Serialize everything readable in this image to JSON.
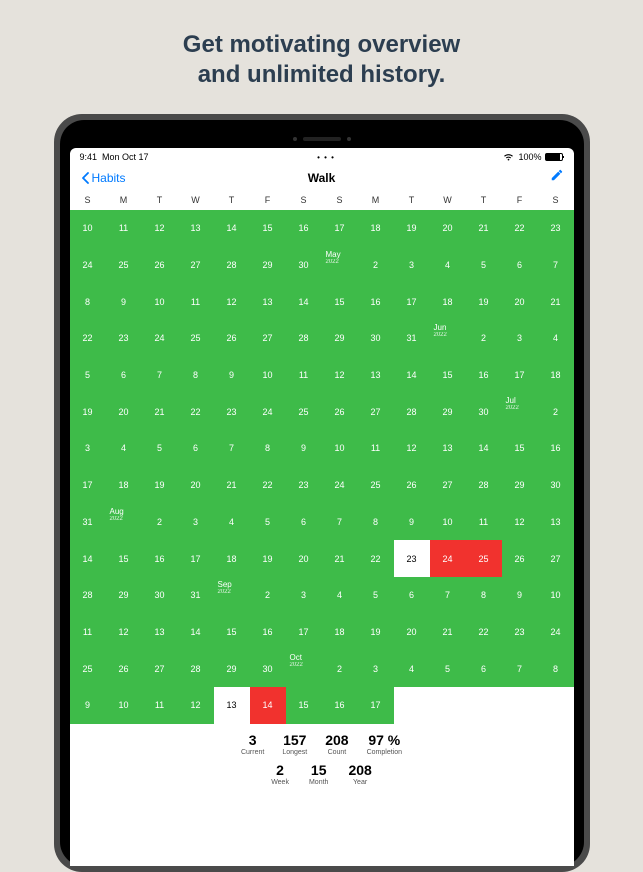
{
  "hero": {
    "line1": "Get motivating overview",
    "line2": "and unlimited history."
  },
  "statusbar": {
    "time": "9:41",
    "date": "Mon Oct 17",
    "battery_pct": "100%"
  },
  "nav": {
    "back_label": "Habits",
    "title": "Walk"
  },
  "day_headers": [
    "S",
    "M",
    "T",
    "W",
    "T",
    "F",
    "S",
    "S",
    "M",
    "T",
    "W",
    "T",
    "F",
    "S"
  ],
  "months": {
    "may": {
      "name": "May",
      "year": "2022"
    },
    "jun": {
      "name": "Jun",
      "year": "2022"
    },
    "jul": {
      "name": "Jul",
      "year": "2022"
    },
    "aug": {
      "name": "Aug",
      "year": "2022"
    },
    "sep": {
      "name": "Sep",
      "year": "2022"
    },
    "oct": {
      "name": "Oct",
      "year": "2022"
    }
  },
  "grid_rows": [
    [
      {
        "d": "10",
        "s": "g"
      },
      {
        "d": "11",
        "s": "g"
      },
      {
        "d": "12",
        "s": "g"
      },
      {
        "d": "13",
        "s": "g"
      },
      {
        "d": "14",
        "s": "g"
      },
      {
        "d": "15",
        "s": "g"
      },
      {
        "d": "16",
        "s": "g"
      },
      {
        "d": "17",
        "s": "g"
      },
      {
        "d": "18",
        "s": "g"
      },
      {
        "d": "19",
        "s": "g"
      },
      {
        "d": "20",
        "s": "g"
      },
      {
        "d": "21",
        "s": "g"
      },
      {
        "d": "22",
        "s": "g"
      },
      {
        "d": "23",
        "s": "g"
      }
    ],
    [
      {
        "d": "24",
        "s": "g"
      },
      {
        "d": "25",
        "s": "g"
      },
      {
        "d": "26",
        "s": "g"
      },
      {
        "d": "27",
        "s": "g"
      },
      {
        "d": "28",
        "s": "g"
      },
      {
        "d": "29",
        "s": "g"
      },
      {
        "d": "30",
        "s": "g"
      },
      {
        "d": "",
        "s": "g",
        "m": "may"
      },
      {
        "d": "2",
        "s": "g"
      },
      {
        "d": "3",
        "s": "g"
      },
      {
        "d": "4",
        "s": "g"
      },
      {
        "d": "5",
        "s": "g"
      },
      {
        "d": "6",
        "s": "g"
      },
      {
        "d": "7",
        "s": "g"
      }
    ],
    [
      {
        "d": "8",
        "s": "g"
      },
      {
        "d": "9",
        "s": "g"
      },
      {
        "d": "10",
        "s": "g"
      },
      {
        "d": "11",
        "s": "g"
      },
      {
        "d": "12",
        "s": "g"
      },
      {
        "d": "13",
        "s": "g"
      },
      {
        "d": "14",
        "s": "g"
      },
      {
        "d": "15",
        "s": "g"
      },
      {
        "d": "16",
        "s": "g"
      },
      {
        "d": "17",
        "s": "g"
      },
      {
        "d": "18",
        "s": "g"
      },
      {
        "d": "19",
        "s": "g"
      },
      {
        "d": "20",
        "s": "g"
      },
      {
        "d": "21",
        "s": "g"
      }
    ],
    [
      {
        "d": "22",
        "s": "g"
      },
      {
        "d": "23",
        "s": "g"
      },
      {
        "d": "24",
        "s": "g"
      },
      {
        "d": "25",
        "s": "g"
      },
      {
        "d": "26",
        "s": "g"
      },
      {
        "d": "27",
        "s": "g"
      },
      {
        "d": "28",
        "s": "g"
      },
      {
        "d": "29",
        "s": "g"
      },
      {
        "d": "30",
        "s": "g"
      },
      {
        "d": "31",
        "s": "g"
      },
      {
        "d": "",
        "s": "g",
        "m": "jun"
      },
      {
        "d": "2",
        "s": "g"
      },
      {
        "d": "3",
        "s": "g"
      },
      {
        "d": "4",
        "s": "g"
      }
    ],
    [
      {
        "d": "5",
        "s": "g"
      },
      {
        "d": "6",
        "s": "g"
      },
      {
        "d": "7",
        "s": "g"
      },
      {
        "d": "8",
        "s": "g"
      },
      {
        "d": "9",
        "s": "g"
      },
      {
        "d": "10",
        "s": "g"
      },
      {
        "d": "11",
        "s": "g"
      },
      {
        "d": "12",
        "s": "g"
      },
      {
        "d": "13",
        "s": "g"
      },
      {
        "d": "14",
        "s": "g"
      },
      {
        "d": "15",
        "s": "g"
      },
      {
        "d": "16",
        "s": "g"
      },
      {
        "d": "17",
        "s": "g"
      },
      {
        "d": "18",
        "s": "g"
      }
    ],
    [
      {
        "d": "19",
        "s": "g"
      },
      {
        "d": "20",
        "s": "g"
      },
      {
        "d": "21",
        "s": "g"
      },
      {
        "d": "22",
        "s": "g"
      },
      {
        "d": "23",
        "s": "g"
      },
      {
        "d": "24",
        "s": "g"
      },
      {
        "d": "25",
        "s": "g"
      },
      {
        "d": "26",
        "s": "g"
      },
      {
        "d": "27",
        "s": "g"
      },
      {
        "d": "28",
        "s": "g"
      },
      {
        "d": "29",
        "s": "g"
      },
      {
        "d": "30",
        "s": "g"
      },
      {
        "d": "",
        "s": "g",
        "m": "jul"
      },
      {
        "d": "2",
        "s": "g"
      }
    ],
    [
      {
        "d": "3",
        "s": "g"
      },
      {
        "d": "4",
        "s": "g"
      },
      {
        "d": "5",
        "s": "g"
      },
      {
        "d": "6",
        "s": "g"
      },
      {
        "d": "7",
        "s": "g"
      },
      {
        "d": "8",
        "s": "g"
      },
      {
        "d": "9",
        "s": "g"
      },
      {
        "d": "10",
        "s": "g"
      },
      {
        "d": "11",
        "s": "g"
      },
      {
        "d": "12",
        "s": "g"
      },
      {
        "d": "13",
        "s": "g"
      },
      {
        "d": "14",
        "s": "g"
      },
      {
        "d": "15",
        "s": "g"
      },
      {
        "d": "16",
        "s": "g"
      }
    ],
    [
      {
        "d": "17",
        "s": "g"
      },
      {
        "d": "18",
        "s": "g"
      },
      {
        "d": "19",
        "s": "g"
      },
      {
        "d": "20",
        "s": "g"
      },
      {
        "d": "21",
        "s": "g"
      },
      {
        "d": "22",
        "s": "g"
      },
      {
        "d": "23",
        "s": "g"
      },
      {
        "d": "24",
        "s": "g"
      },
      {
        "d": "25",
        "s": "g"
      },
      {
        "d": "26",
        "s": "g"
      },
      {
        "d": "27",
        "s": "g"
      },
      {
        "d": "28",
        "s": "g"
      },
      {
        "d": "29",
        "s": "g"
      },
      {
        "d": "30",
        "s": "g"
      }
    ],
    [
      {
        "d": "31",
        "s": "g"
      },
      {
        "d": "",
        "s": "g",
        "m": "aug"
      },
      {
        "d": "2",
        "s": "g"
      },
      {
        "d": "3",
        "s": "g"
      },
      {
        "d": "4",
        "s": "g"
      },
      {
        "d": "5",
        "s": "g"
      },
      {
        "d": "6",
        "s": "g"
      },
      {
        "d": "7",
        "s": "g"
      },
      {
        "d": "8",
        "s": "g"
      },
      {
        "d": "9",
        "s": "g"
      },
      {
        "d": "10",
        "s": "g"
      },
      {
        "d": "11",
        "s": "g"
      },
      {
        "d": "12",
        "s": "g"
      },
      {
        "d": "13",
        "s": "g"
      }
    ],
    [
      {
        "d": "14",
        "s": "g"
      },
      {
        "d": "15",
        "s": "g"
      },
      {
        "d": "16",
        "s": "g"
      },
      {
        "d": "17",
        "s": "g"
      },
      {
        "d": "18",
        "s": "g"
      },
      {
        "d": "19",
        "s": "g"
      },
      {
        "d": "20",
        "s": "g"
      },
      {
        "d": "21",
        "s": "g"
      },
      {
        "d": "22",
        "s": "g"
      },
      {
        "d": "23",
        "s": "w"
      },
      {
        "d": "24",
        "s": "r"
      },
      {
        "d": "25",
        "s": "r"
      },
      {
        "d": "26",
        "s": "g"
      },
      {
        "d": "27",
        "s": "g"
      }
    ],
    [
      {
        "d": "28",
        "s": "g"
      },
      {
        "d": "29",
        "s": "g"
      },
      {
        "d": "30",
        "s": "g"
      },
      {
        "d": "31",
        "s": "g"
      },
      {
        "d": "",
        "s": "g",
        "m": "sep"
      },
      {
        "d": "2",
        "s": "g"
      },
      {
        "d": "3",
        "s": "g"
      },
      {
        "d": "4",
        "s": "g"
      },
      {
        "d": "5",
        "s": "g"
      },
      {
        "d": "6",
        "s": "g"
      },
      {
        "d": "7",
        "s": "g"
      },
      {
        "d": "8",
        "s": "g"
      },
      {
        "d": "9",
        "s": "g"
      },
      {
        "d": "10",
        "s": "g"
      }
    ],
    [
      {
        "d": "11",
        "s": "g"
      },
      {
        "d": "12",
        "s": "g"
      },
      {
        "d": "13",
        "s": "g"
      },
      {
        "d": "14",
        "s": "g"
      },
      {
        "d": "15",
        "s": "g"
      },
      {
        "d": "16",
        "s": "g"
      },
      {
        "d": "17",
        "s": "g"
      },
      {
        "d": "18",
        "s": "g"
      },
      {
        "d": "19",
        "s": "g"
      },
      {
        "d": "20",
        "s": "g"
      },
      {
        "d": "21",
        "s": "g"
      },
      {
        "d": "22",
        "s": "g"
      },
      {
        "d": "23",
        "s": "g"
      },
      {
        "d": "24",
        "s": "g"
      }
    ],
    [
      {
        "d": "25",
        "s": "g"
      },
      {
        "d": "26",
        "s": "g"
      },
      {
        "d": "27",
        "s": "g"
      },
      {
        "d": "28",
        "s": "g"
      },
      {
        "d": "29",
        "s": "g"
      },
      {
        "d": "30",
        "s": "g"
      },
      {
        "d": "",
        "s": "g",
        "m": "oct"
      },
      {
        "d": "2",
        "s": "g"
      },
      {
        "d": "3",
        "s": "g"
      },
      {
        "d": "4",
        "s": "g"
      },
      {
        "d": "5",
        "s": "g"
      },
      {
        "d": "6",
        "s": "g"
      },
      {
        "d": "7",
        "s": "g"
      },
      {
        "d": "8",
        "s": "g"
      }
    ],
    [
      {
        "d": "9",
        "s": "g"
      },
      {
        "d": "10",
        "s": "g"
      },
      {
        "d": "11",
        "s": "g"
      },
      {
        "d": "12",
        "s": "g"
      },
      {
        "d": "13",
        "s": "w"
      },
      {
        "d": "14",
        "s": "r"
      },
      {
        "d": "15",
        "s": "g"
      },
      {
        "d": "16",
        "s": "g"
      },
      {
        "d": "17",
        "s": "g"
      },
      {
        "d": "",
        "s": "w"
      },
      {
        "d": "",
        "s": "w"
      },
      {
        "d": "",
        "s": "w"
      },
      {
        "d": "",
        "s": "w"
      },
      {
        "d": "",
        "s": "w"
      }
    ]
  ],
  "stats_top": [
    {
      "v": "3",
      "l": "Current"
    },
    {
      "v": "157",
      "l": "Longest"
    },
    {
      "v": "208",
      "l": "Count"
    },
    {
      "v": "97 %",
      "l": "Completion"
    }
  ],
  "stats_bottom": [
    {
      "v": "2",
      "l": "Week"
    },
    {
      "v": "15",
      "l": "Month"
    },
    {
      "v": "208",
      "l": "Year"
    }
  ]
}
